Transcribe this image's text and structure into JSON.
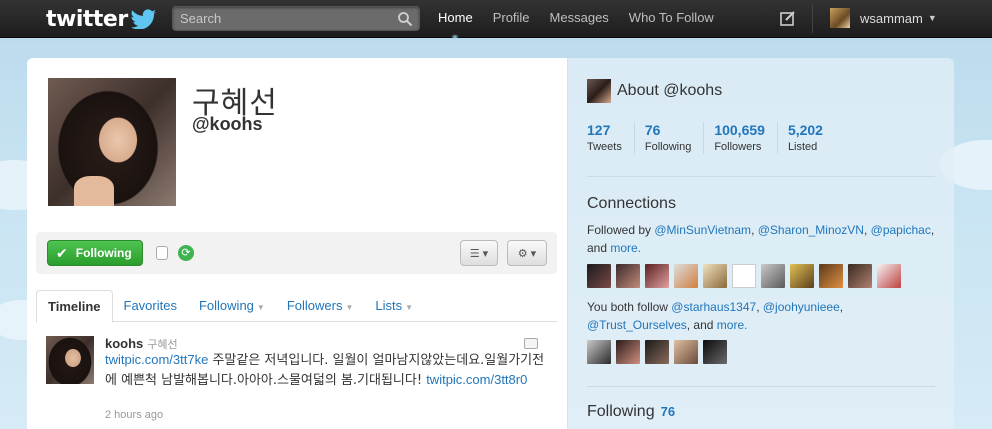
{
  "topbar": {
    "logo": "twitter",
    "search_placeholder": "Search",
    "nav": [
      "Home",
      "Profile",
      "Messages",
      "Who To Follow"
    ],
    "account_name": "wsammam"
  },
  "profile": {
    "name": "구혜선",
    "handle": "@koohs",
    "follow_label": "Following"
  },
  "tabs": [
    {
      "label": "Timeline",
      "active": true
    },
    {
      "label": "Favorites"
    },
    {
      "label": "Following"
    },
    {
      "label": "Followers"
    },
    {
      "label": "Lists"
    }
  ],
  "tweet": {
    "username": "koohs",
    "display_name": "구혜선",
    "link1": "twitpic.com/3tt7ke",
    "text": " 주말같은 저녁입니다. 일월이 얼마남지않았는데요.일월가기전에 예쁜척 남발해봅니다.아아아.스물여덟의 봄.기대됩니다! ",
    "link2": "twitpic.com/3tt8r0",
    "time": "2 hours ago"
  },
  "sidebar": {
    "about": "About @koohs",
    "stats": [
      {
        "num": "127",
        "label": "Tweets"
      },
      {
        "num": "76",
        "label": "Following"
      },
      {
        "num": "100,659",
        "label": "Followers"
      },
      {
        "num": "5,202",
        "label": "Listed"
      }
    ],
    "connections_title": "Connections",
    "followed_by_prefix": "Followed by ",
    "followed_by": [
      "@MinSunVietnam",
      "@Sharon_MinozVN",
      "@papichac"
    ],
    "and_text": ", and ",
    "more": "more.",
    "both_follow_prefix": "You both follow ",
    "both_follow": [
      "@starhaus1347",
      "@joohyunieee",
      "@Trust_Ourselves"
    ],
    "following_title": "Following",
    "following_count": "76"
  },
  "colors": {
    "link": "#2276bb",
    "follow_green": "#2a9d2d",
    "topbar": "#1d1d1d"
  }
}
